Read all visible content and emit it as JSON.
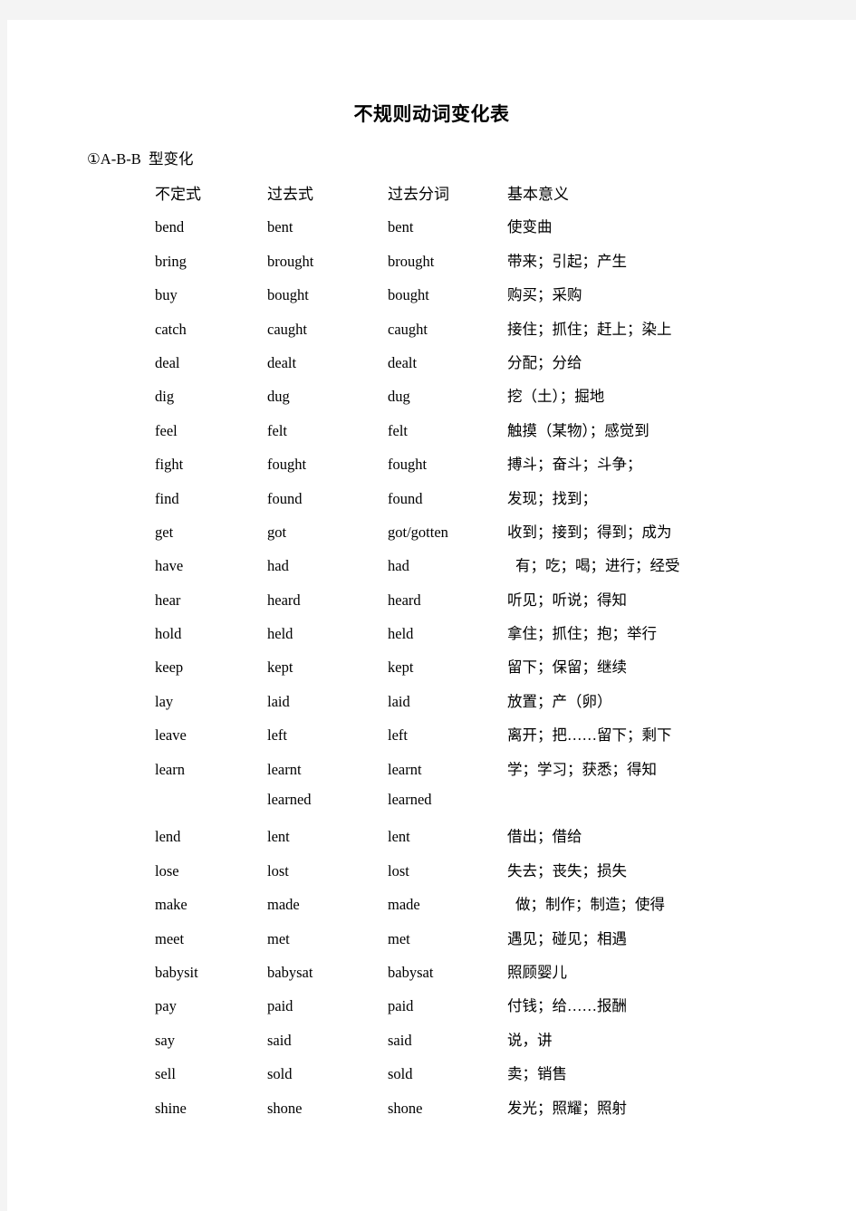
{
  "document": {
    "title": "不规则动词变化表",
    "section_heading": "①A-B-B  型变化"
  },
  "table": {
    "headers": {
      "infinitive": "不定式",
      "past": "过去式",
      "participle": "过去分词",
      "meaning": "基本意义"
    },
    "rows": [
      {
        "infinitive": "bend",
        "past": "bent",
        "participle": "bent",
        "meaning": "使变曲",
        "indent": false
      },
      {
        "infinitive": "bring",
        "past": "brought",
        "participle": "brought",
        "meaning": "带来；引起；产生",
        "indent": false
      },
      {
        "infinitive": "buy",
        "past": "bought",
        "participle": "bought",
        "meaning": "购买；采购",
        "indent": false
      },
      {
        "infinitive": "catch",
        "past": "caught",
        "participle": "caught",
        "meaning": "接住；抓住；赶上；染上",
        "indent": false
      },
      {
        "infinitive": "deal",
        "past": "dealt",
        "participle": "dealt",
        "meaning": "分配；分给",
        "indent": false
      },
      {
        "infinitive": "dig",
        "past": "dug",
        "participle": "dug",
        "meaning": "挖（土）；掘地",
        "indent": false
      },
      {
        "infinitive": "feel",
        "past": "felt",
        "participle": "felt",
        "meaning": "触摸（某物）；感觉到",
        "indent": false
      },
      {
        "infinitive": "fight",
        "past": "fought",
        "participle": "fought",
        "meaning": "搏斗；奋斗；斗争；",
        "indent": false
      },
      {
        "infinitive": "find",
        "past": "found",
        "participle": "found",
        "meaning": "发现；找到；",
        "indent": false
      },
      {
        "infinitive": "get",
        "past": "got",
        "participle": "got/gotten",
        "meaning": "收到；接到；得到；成为",
        "indent": false
      },
      {
        "infinitive": "have",
        "past": "had",
        "participle": "had",
        "meaning": "有；吃；喝；进行；经受",
        "indent": true
      },
      {
        "infinitive": "hear",
        "past": "heard",
        "participle": "heard",
        "meaning": "听见；听说；得知",
        "indent": false
      },
      {
        "infinitive": "hold",
        "past": "held",
        "participle": "held",
        "meaning": "拿住；抓住；抱；举行",
        "indent": false
      },
      {
        "infinitive": "keep",
        "past": "kept",
        "participle": "kept",
        "meaning": "留下；保留；继续",
        "indent": false
      },
      {
        "infinitive": "lay",
        "past": "laid",
        "participle": "laid",
        "meaning": "放置；产（卵）",
        "indent": false
      },
      {
        "infinitive": "leave",
        "past": "left",
        "participle": "left",
        "meaning": "离开；把……留下；剩下",
        "indent": false
      },
      {
        "infinitive": "learn",
        "past": "learnt",
        "participle": "learnt",
        "meaning": "学；学习；获悉；得知",
        "indent": false
      },
      {
        "infinitive": "",
        "past": "learned",
        "participle": "learned",
        "meaning": "",
        "indent": false
      },
      {
        "infinitive": "lend",
        "past": "lent",
        "participle": "lent",
        "meaning": "借出；借给",
        "indent": false
      },
      {
        "infinitive": "lose",
        "past": "lost",
        "participle": "lost",
        "meaning": "失去；丧失；损失",
        "indent": false
      },
      {
        "infinitive": "make",
        "past": "made",
        "participle": "made",
        "meaning": "做；制作；制造；使得",
        "indent": true
      },
      {
        "infinitive": "meet",
        "past": "met",
        "participle": "met",
        "meaning": "遇见；碰见；相遇",
        "indent": false
      },
      {
        "infinitive": "babysit",
        "past": "babysat",
        "participle": "babysat",
        "meaning": "照顾婴儿",
        "indent": false
      },
      {
        "infinitive": "pay",
        "past": "paid",
        "participle": "paid",
        "meaning": "付钱；给……报酬",
        "indent": false
      },
      {
        "infinitive": "say",
        "past": "said",
        "participle": "said",
        "meaning": "说，讲",
        "indent": false
      },
      {
        "infinitive": "sell",
        "past": "sold",
        "participle": "sold",
        "meaning": "卖；销售",
        "indent": false
      },
      {
        "infinitive": "shine",
        "past": "shone",
        "participle": "shone",
        "meaning": "发光；照耀；照射",
        "indent": false
      }
    ]
  }
}
